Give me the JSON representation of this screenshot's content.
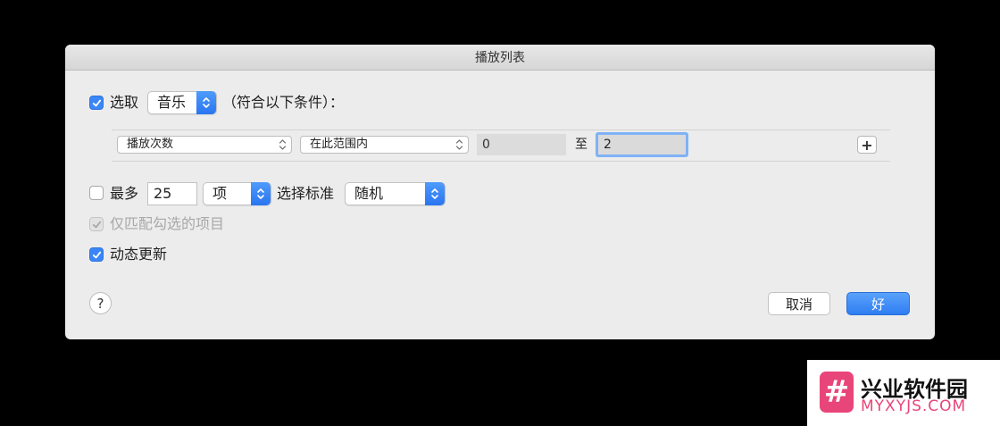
{
  "dialog": {
    "title": "播放列表",
    "limit_select": {
      "checked": true,
      "label": "选取",
      "media_type": "音乐",
      "suffix": "（符合以下条件）："
    },
    "rule": {
      "field": "播放次数",
      "operator": "在此范围内",
      "from_value": "0",
      "to_label": "至",
      "to_value": "2",
      "add_label": "+"
    },
    "limit": {
      "checked": false,
      "label": "最多",
      "count": "25",
      "unit": "项",
      "criteria_label": "选择标准",
      "criteria": "随机"
    },
    "match_checked": {
      "checked": true,
      "disabled": true,
      "label": "仅匹配勾选的项目"
    },
    "live_update": {
      "checked": true,
      "label": "动态更新"
    },
    "help_label": "?",
    "cancel_label": "取消",
    "ok_label": "好"
  },
  "watermark": {
    "logo_glyph": "#",
    "title": "兴业软件园",
    "url": "MYXYJS.COM"
  },
  "colors": {
    "accent": "#3b86f7",
    "background": "#000000",
    "dialog": "#ececec",
    "watermark_pink": "#e8457a"
  }
}
